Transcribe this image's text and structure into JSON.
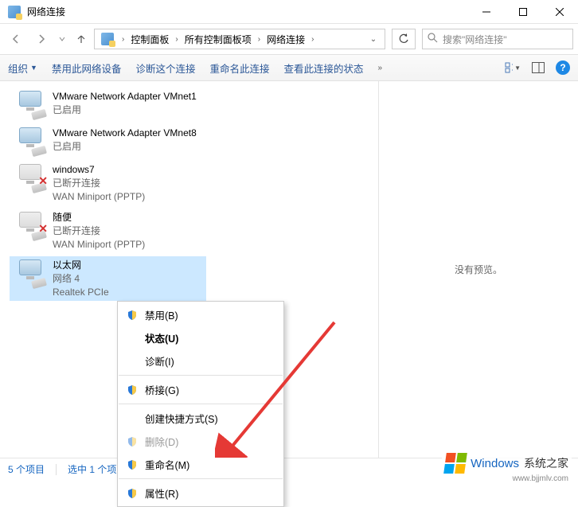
{
  "window": {
    "title": "网络连接"
  },
  "breadcrumbs": {
    "b0": "控制面板",
    "b1": "所有控制面板项",
    "b2": "网络连接"
  },
  "search": {
    "placeholder": "搜索\"网络连接\""
  },
  "toolbar": {
    "organize": "组织",
    "disable": "禁用此网络设备",
    "diagnose": "诊断这个连接",
    "rename": "重命名此连接",
    "view_status": "查看此连接的状态"
  },
  "adapters": [
    {
      "name": "VMware Network Adapter VMnet1",
      "status": "已启用",
      "device": ""
    },
    {
      "name": "VMware Network Adapter VMnet8",
      "status": "已启用",
      "device": ""
    },
    {
      "name": "windows7",
      "status": "已断开连接",
      "device": "WAN Miniport (PPTP)"
    },
    {
      "name": "随便",
      "status": "已断开连接",
      "device": "WAN Miniport (PPTP)"
    },
    {
      "name": "以太网",
      "status": "网络 4",
      "device": "Realtek PCIe"
    }
  ],
  "context_menu": {
    "disable": "禁用(B)",
    "status": "状态(U)",
    "diagnose": "诊断(I)",
    "bridge": "桥接(G)",
    "shortcut": "创建快捷方式(S)",
    "delete": "删除(D)",
    "rename": "重命名(M)",
    "properties": "属性(R)"
  },
  "preview": {
    "empty": "没有预览。"
  },
  "statusbar": {
    "count": "5 个项目",
    "selected": "选中 1 个项目"
  },
  "watermark": {
    "brand": "Windows",
    "sub": "系统之家",
    "url": "www.bjjmlv.com"
  }
}
